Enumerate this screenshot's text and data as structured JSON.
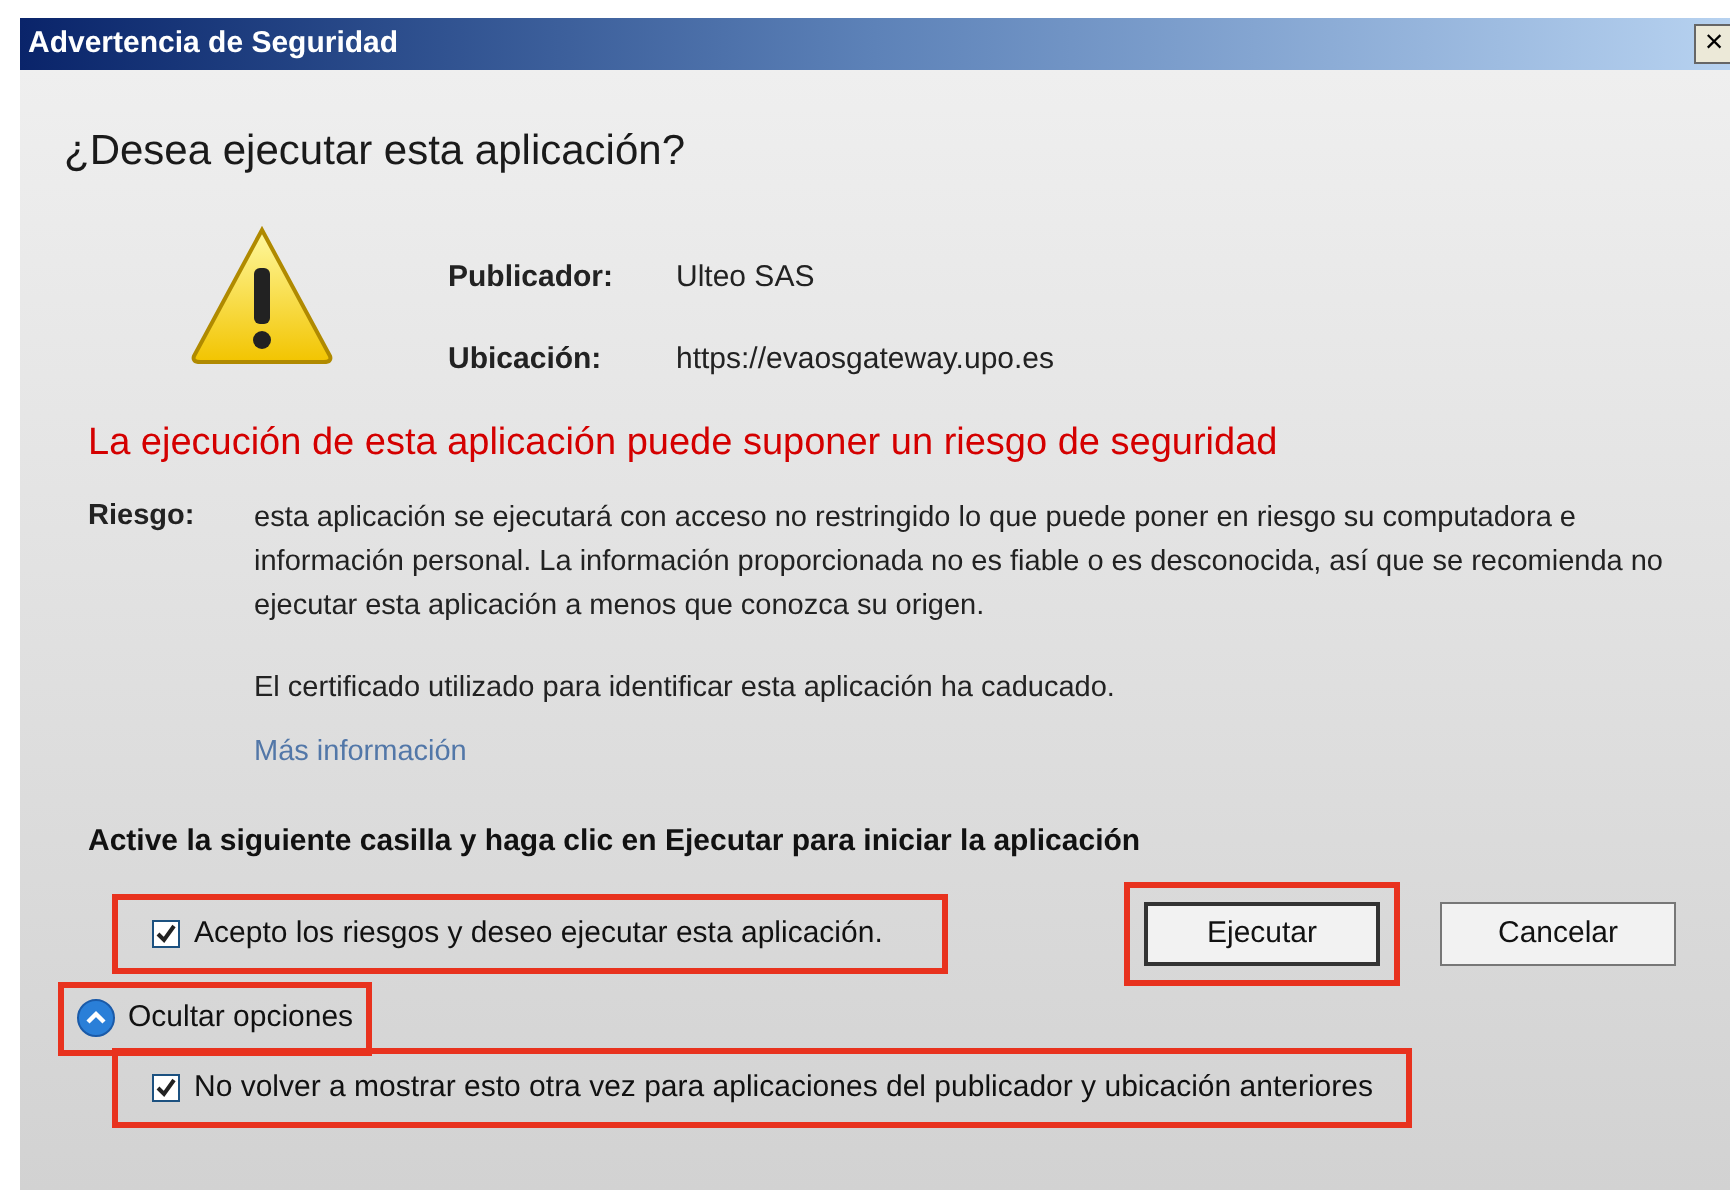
{
  "window": {
    "title": "Advertencia de Seguridad",
    "close": "×"
  },
  "question": "¿Desea ejecutar esta aplicación?",
  "details": [
    {
      "label": "Publicador:",
      "value": "Ulteo SAS"
    },
    {
      "label": "Ubicación:",
      "value": "https://evaosgateway.upo.es"
    }
  ],
  "warning": "La ejecución de esta aplicación puede suponer un riesgo de seguridad",
  "risk": {
    "label": "Riesgo:",
    "text": "esta aplicación se ejecutará con acceso no restringido lo que puede poner en riesgo su computadora e información personal. La información proporcionada no es fiable o es desconocida, así que se recomienda no ejecutar esta aplicación a menos que conozca su origen.",
    "certificate": "El certificado utilizado para identificar esta aplicación ha caducado.",
    "link": "Más información"
  },
  "instruction": "Active la siguiente casilla y haga clic en Ejecutar para iniciar la aplicación",
  "accept": {
    "label": "Acepto los riesgos y deseo ejecutar esta aplicación.",
    "checked": true,
    "highlighted": true
  },
  "buttons": [
    {
      "label": "Ejecutar",
      "default": true,
      "highlighted": true
    },
    {
      "label": "Cancelar",
      "default": false,
      "highlighted": false
    }
  ],
  "options_toggle": {
    "label": "Ocultar opciones",
    "expanded": true,
    "highlighted": true
  },
  "remember": {
    "label": "No volver a mostrar esto otra vez para aplicaciones del publicador y ubicación anteriores",
    "checked": true,
    "highlighted": true
  }
}
